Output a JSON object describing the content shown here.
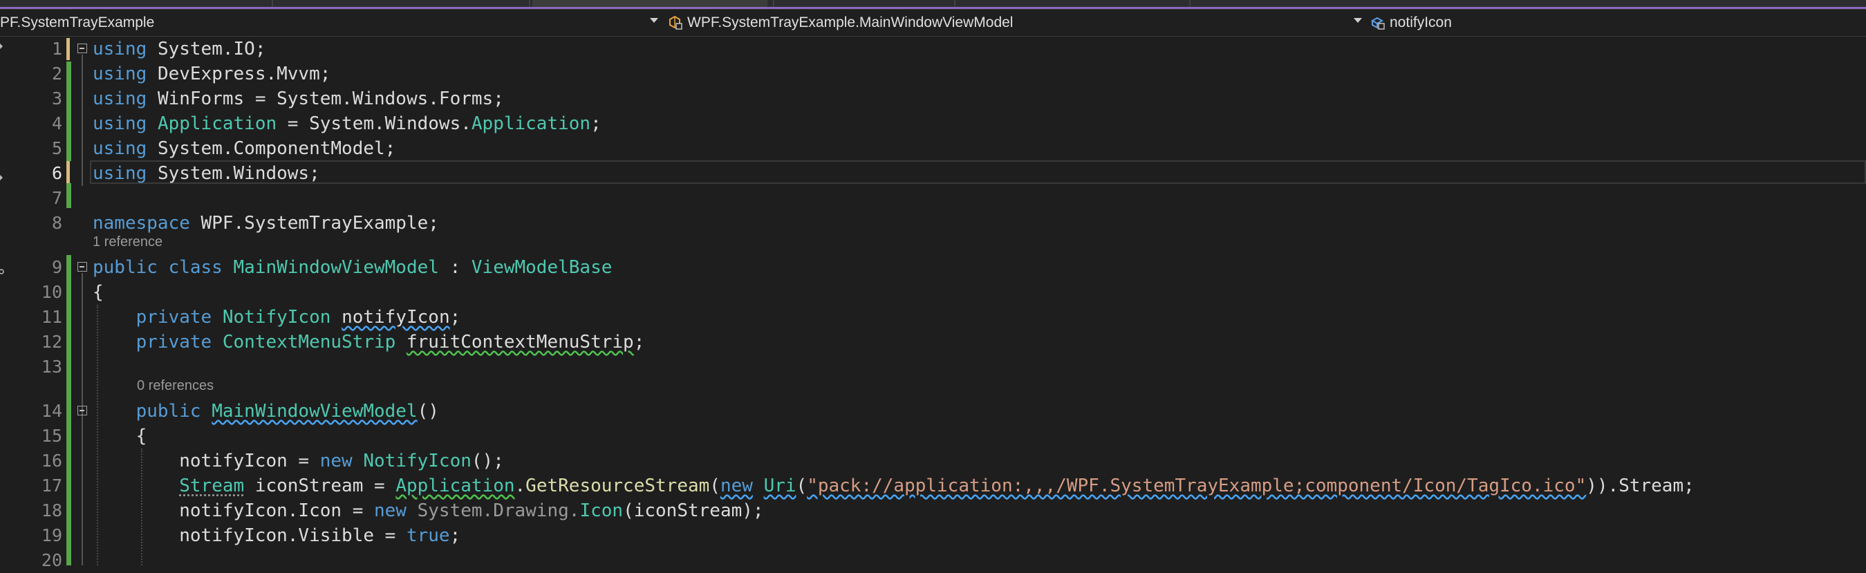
{
  "nav": {
    "project": "PF.SystemTrayExample",
    "type_scope": "WPF.SystemTrayExample.MainWindowViewModel",
    "member_scope": "notifyIcon"
  },
  "codelens": {
    "class_refs": "1 reference",
    "ctor_refs": "0 references"
  },
  "current_line": 6,
  "lines": [
    {
      "n": "1"
    },
    {
      "n": "2"
    },
    {
      "n": "3"
    },
    {
      "n": "4"
    },
    {
      "n": "5"
    },
    {
      "n": "6"
    },
    {
      "n": "7"
    },
    {
      "n": "8"
    },
    {
      "n": "9"
    },
    {
      "n": "10"
    },
    {
      "n": "11"
    },
    {
      "n": "12"
    },
    {
      "n": "13"
    },
    {
      "n": "14"
    },
    {
      "n": "15"
    },
    {
      "n": "16"
    },
    {
      "n": "17"
    },
    {
      "n": "18"
    },
    {
      "n": "19"
    },
    {
      "n": "20"
    }
  ],
  "code": {
    "l1": [
      "using",
      "System.IO;"
    ],
    "l2": [
      "using",
      "DevExpress.Mvvm;"
    ],
    "l3": [
      "using",
      "WinForms = System.Windows.Forms;"
    ],
    "l4": [
      "using",
      "Application",
      " = System.Windows.",
      "Application",
      ";"
    ],
    "l5": [
      "using",
      "System.ComponentModel;"
    ],
    "l6": [
      "using",
      "System.Windows;"
    ],
    "l8": [
      "namespace",
      "WPF.SystemTrayExample;"
    ],
    "l9": [
      "public class",
      "MainWindowViewModel",
      " : ",
      "ViewModelBase"
    ],
    "l10": [
      "{"
    ],
    "l11": [
      "private",
      "NotifyIcon",
      "notifyIcon",
      ";"
    ],
    "l12": [
      "private",
      "ContextMenuStrip",
      "fruitContextMenuStrip",
      ";"
    ],
    "l14": [
      "public",
      "MainWindowViewModel",
      "()"
    ],
    "l15": [
      "{"
    ],
    "l16": [
      "notifyIcon = ",
      "new",
      "NotifyIcon",
      "();"
    ],
    "l17": [
      "Stream",
      "iconStream",
      " = ",
      "Application",
      ".",
      "GetResourceStream",
      "(",
      "new",
      "Uri",
      "(",
      "\"pack://application:,,,/WPF.SystemTrayExample;component/Icon/TagIco.ico\"",
      ")).Stream;"
    ],
    "l18": [
      "notifyIcon.Icon = ",
      "new",
      "System.Drawing.",
      "Icon",
      "(iconStream);"
    ],
    "l19": [
      "notifyIcon.Visible = ",
      "true",
      ";"
    ]
  },
  "colors": {
    "keyword": "#569cd6",
    "type": "#4ec9b0",
    "string": "#d69d85",
    "method": "#dcdcaa",
    "changed_line": "#57a64a",
    "unsaved_line": "#d7ba7d"
  },
  "icons": {
    "type_scope": "class-icon",
    "member_scope": "field-icon"
  }
}
